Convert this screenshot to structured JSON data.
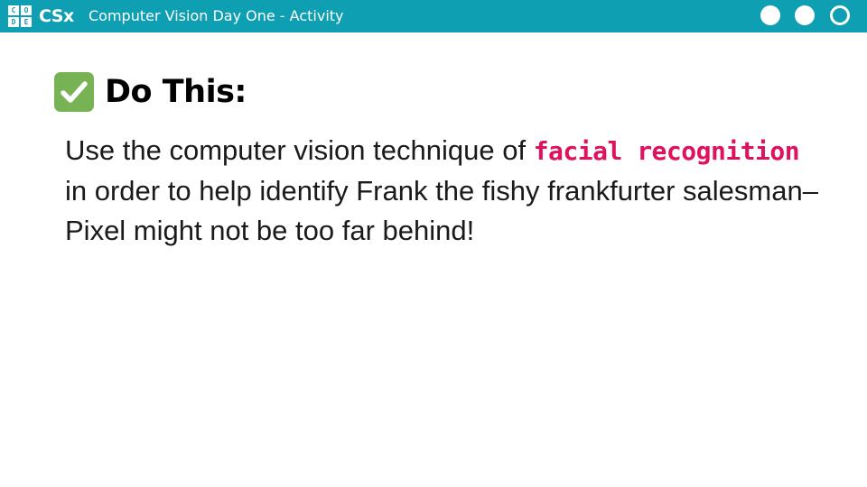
{
  "header": {
    "logo_letters": [
      "C",
      "O",
      "D",
      "E"
    ],
    "brand": "CSx",
    "title": "Computer Vision Day One - Activity",
    "progress_dots": [
      {
        "state": "filled",
        "icon": "circle-filled-icon"
      },
      {
        "state": "filled",
        "icon": "circle-filled-icon"
      },
      {
        "state": "outline",
        "icon": "circle-outline-icon"
      }
    ],
    "bar_color": "#0f9fb2"
  },
  "content": {
    "heading_icon": "check-mark-icon",
    "heading": "Do This:",
    "body": {
      "before": "Use the computer vision technique of ",
      "highlight": "facial recognition",
      "after": " in order to help identify Frank the fishy frankfurter salesman– Pixel might not be too far behind!"
    },
    "highlight_color": "#e0115f",
    "check_color": "#77b255"
  }
}
